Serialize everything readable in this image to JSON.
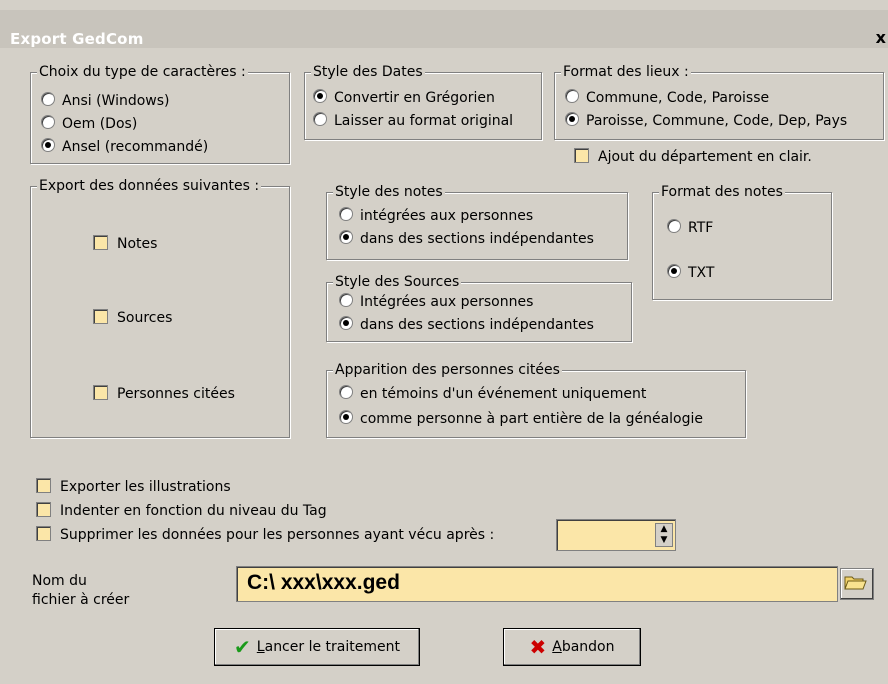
{
  "window": {
    "title": "Export GedCom",
    "close": "x"
  },
  "charset": {
    "legend": "Choix du type de caractères :",
    "options": [
      "Ansi (Windows)",
      "Oem (Dos)",
      "Ansel (recommandé)"
    ],
    "selected": 2
  },
  "date_style": {
    "legend": "Style des Dates",
    "options": [
      "Convertir en Grégorien",
      "Laisser au format original"
    ],
    "selected": 0
  },
  "place_format": {
    "legend": "Format des lieux :",
    "options": [
      "Commune, Code, Paroisse",
      "Paroisse, Commune, Code, Dep, Pays"
    ],
    "selected": 1,
    "dept_label": "Ajout du département en clair."
  },
  "export_data": {
    "legend": "Export des données suivantes :",
    "items": [
      "Notes",
      "Sources",
      "Personnes citées"
    ]
  },
  "notes_style": {
    "legend": "Style des notes",
    "options": [
      "intégrées aux personnes",
      "dans des sections indépendantes"
    ],
    "selected": 1
  },
  "notes_format": {
    "legend": "Format des notes",
    "options": [
      "RTF",
      "TXT"
    ],
    "selected": 1
  },
  "sources_style": {
    "legend": "Style des Sources",
    "options": [
      "Intégrées aux personnes",
      "dans des sections indépendantes"
    ],
    "selected": 1
  },
  "cited_persons": {
    "legend": "Apparition des personnes citées",
    "options": [
      "en témoins d'un événement uniquement",
      "comme personne à part entière de la généalogie"
    ],
    "selected": 1
  },
  "options": {
    "export_illustrations": "Exporter les illustrations",
    "indent_tag": "Indenter en fonction du niveau du Tag",
    "suppress_data": "Supprimer les données pour les personnes ayant vécu après :"
  },
  "file": {
    "label_line1": "Nom du",
    "label_line2": "fichier à créer",
    "path": "C:\\ xxx\\xxx.ged"
  },
  "buttons": {
    "start_first": "L",
    "start_rest": "ancer le traitement",
    "abort_first": "A",
    "abort_rest": "bandon"
  },
  "colors": {
    "field_bg": "#fbe6a8",
    "dialog_bg": "#d4d0c8",
    "check_green": "#1a9a1a",
    "cross_red": "#cc0000"
  }
}
